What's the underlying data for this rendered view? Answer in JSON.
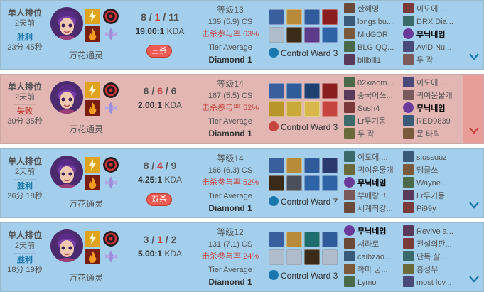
{
  "colors": {
    "win_bg": "#a3cfec",
    "loss_bg": "#e2b6b3",
    "win_text": "#1a78ae",
    "loss_text": "#c6443e",
    "badge": "#ee5a52"
  },
  "matches": [
    {
      "result": "win",
      "type": "单人排位",
      "time_ago": "2天前",
      "result_text": "胜利",
      "duration": "23分 45秒",
      "champion": "万花通灵",
      "kills": "8",
      "deaths": "1",
      "assists": "11",
      "kda_ratio": "19.00:1",
      "kda_label": "KDA",
      "multikill": "三杀",
      "level": "等级13",
      "cs": "139 (5.9) CS",
      "kp": "击杀参与率 63%",
      "tier_label": "Tier Average",
      "tier": "Diamond 1",
      "ward": "Control Ward 3",
      "items": [
        "#3a5f9e",
        "#b88b3a",
        "#2f5b9a",
        "#8a1e1e",
        "#c7cfd8",
        "#3a2a18",
        "#5c3a8a",
        "#2f63a8"
      ],
      "team1": [
        "한혜영",
        "longsibu...",
        "MidGOR",
        "BLG QQ...",
        "bilibili1"
      ],
      "team2": [
        "이도에 ...",
        "DRX Dia...",
        "무닉네임",
        "AviD Nu...",
        "두 곽"
      ],
      "self_team": 2,
      "self_index": 2
    },
    {
      "result": "loss",
      "type": "单人排位",
      "time_ago": "2天前",
      "result_text": "失败",
      "duration": "30分 35秒",
      "champion": "万花通灵",
      "kills": "6",
      "deaths": "6",
      "assists": "6",
      "kda_ratio": "2.00:1",
      "kda_label": "KDA",
      "multikill": "",
      "level": "等级14",
      "cs": "167 (5.5) CS",
      "kp": "击杀参与率 52%",
      "tier_label": "Tier Average",
      "tier": "Diamond 1",
      "ward": "Control Ward 3",
      "items": [
        "#3a5f9e",
        "#2f5b9a",
        "#1f3f6e",
        "#8a1e1e",
        "#b8962a",
        "#c9a93a",
        "#d8b84a",
        "#c6443e"
      ],
      "team1": [
        "02xiaom...",
        "중국어쓰...",
        "Sush4",
        "Lr무기동",
        "두 곽"
      ],
      "team2": [
        "이도에 ...",
        "귀여운물개",
        "무닉네임",
        "RED9839",
        "문 타릭"
      ],
      "self_team": 2,
      "self_index": 2
    },
    {
      "result": "win",
      "type": "单人排位",
      "time_ago": "2天前",
      "result_text": "胜利",
      "duration": "26分 18秒",
      "champion": "万花通灵",
      "kills": "8",
      "deaths": "4",
      "assists": "9",
      "kda_ratio": "4.25:1",
      "kda_label": "KDA",
      "multikill": "双杀",
      "level": "等级14",
      "cs": "166 (6.3) CS",
      "kp": "击杀参与率 52%",
      "tier_label": "Tier Average",
      "tier": "Diamond 1",
      "ward": "Control Ward 7",
      "items": [
        "#3a5f9e",
        "#b88b3a",
        "#2f5b9a",
        "#2a3a6e",
        "#3a2a18",
        "#4a4f5a",
        "#2f63a8",
        "#2f63a8"
      ],
      "team1": [
        "이도에 ...",
        "귀여운물개",
        "무닉네임",
        "부메랑크...",
        "세계최강..."
      ],
      "team2": [
        "siussuuz",
        "땡글쓰",
        "Wayne ...",
        "Lr무기동",
        "Pi99y"
      ],
      "self_team": 1,
      "self_index": 2
    },
    {
      "result": "win",
      "type": "单人排位",
      "time_ago": "2天前",
      "result_text": "胜利",
      "duration": "18分 19秒",
      "champion": "万花通灵",
      "kills": "3",
      "deaths": "1",
      "assists": "2",
      "kda_ratio": "5.00:1",
      "kda_label": "KDA",
      "multikill": "",
      "level": "等级12",
      "cs": "131 (7.1) CS",
      "kp": "击杀参与率 24%",
      "tier_label": "Tier Average",
      "tier": "Diamond 1",
      "ward": "Control Ward 3",
      "items": [
        "#3a5f9e",
        "#b88b3a",
        "#1f6e6e",
        "#2f5b9a",
        "#c7cfd8",
        "#c7cfd8",
        "#3a2a18",
        "#c7cfd8"
      ],
      "team1": [
        "무닉네임",
        "서라로",
        "caibzao...",
        "확마 궁...",
        "Lymo"
      ],
      "team2": [
        "Revive a...",
        "전설의판...",
        "단독 살...",
        "홍성우",
        "most lov..."
      ],
      "self_team": 1,
      "self_index": 0
    }
  ]
}
